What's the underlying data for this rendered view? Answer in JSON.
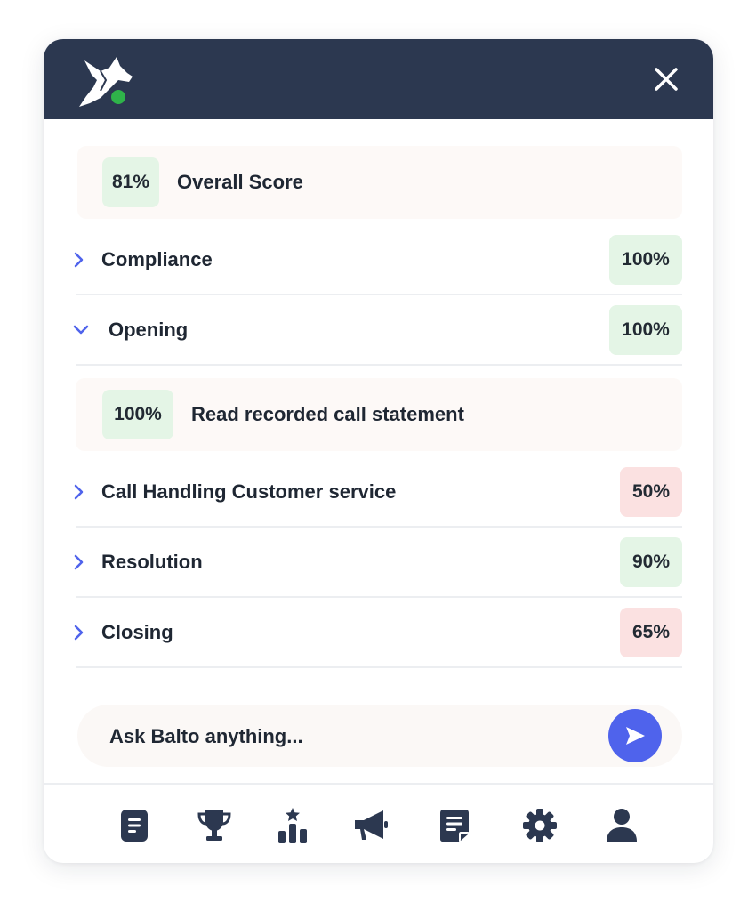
{
  "header": {
    "logo_icon": "dog-logo-icon",
    "status_color": "#2fb34a",
    "close_icon": "close-icon"
  },
  "overall": {
    "score": "81%",
    "label": "Overall Score"
  },
  "categories": [
    {
      "label": "Compliance",
      "score": "100%",
      "status": "green",
      "expanded": false
    },
    {
      "label": "Opening",
      "score": "100%",
      "status": "green",
      "expanded": true
    },
    {
      "label": "Call Handling Customer service",
      "score": "50%",
      "status": "red",
      "expanded": false
    },
    {
      "label": "Resolution",
      "score": "90%",
      "status": "green",
      "expanded": false
    },
    {
      "label": "Closing",
      "score": "65%",
      "status": "red",
      "expanded": false
    }
  ],
  "opening_detail": {
    "score": "100%",
    "label": "Read recorded call statement"
  },
  "chat": {
    "placeholder": "Ask Balto anything...",
    "send_icon": "send-icon"
  },
  "nav": [
    {
      "icon": "document-icon"
    },
    {
      "icon": "trophy-icon"
    },
    {
      "icon": "leaderboard-icon"
    },
    {
      "icon": "megaphone-icon"
    },
    {
      "icon": "notes-icon"
    },
    {
      "icon": "gear-icon"
    },
    {
      "icon": "user-icon"
    }
  ],
  "colors": {
    "header_bg": "#2c3850",
    "accent": "#4f63ec",
    "badge_green": "#e4f5e6",
    "badge_red": "#fbe1e1"
  }
}
